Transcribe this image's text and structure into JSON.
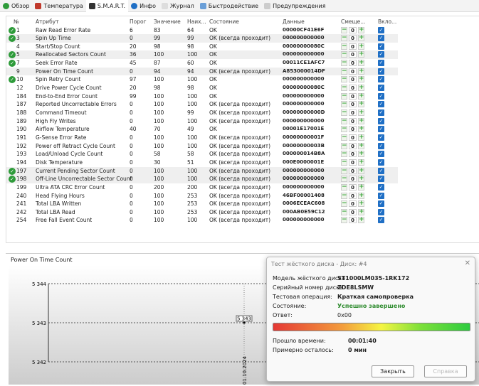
{
  "tabs": [
    {
      "label": "Обзор",
      "icon": "check-circle-icon"
    },
    {
      "label": "Температура",
      "icon": "thermometer-icon"
    },
    {
      "label": "S.M.A.R.T.",
      "icon": "drive-icon"
    },
    {
      "label": "Инфо",
      "icon": "info-icon"
    },
    {
      "label": "Журнал",
      "icon": "document-icon"
    },
    {
      "label": "Быстродействие",
      "icon": "chart-icon"
    },
    {
      "label": "Предупреждения",
      "icon": "warning-doc-icon"
    }
  ],
  "active_tab": "S.M.A.R.T.",
  "columns": [
    "№",
    "Атрибут",
    "Порог",
    "Значение",
    "Наих...",
    "Состояние",
    "Данные",
    "Смеще...",
    "Вкло..."
  ],
  "rows": [
    [
      "1",
      "Raw Read Error Rate",
      "6",
      "83",
      "64",
      "OK",
      "00000CF41E6F",
      true
    ],
    [
      "3",
      "Spin Up Time",
      "0",
      "99",
      "99",
      "OK (всегда проходит)",
      "000000000000",
      true
    ],
    [
      "4",
      "Start/Stop Count",
      "20",
      "98",
      "98",
      "OK",
      "00000000080C",
      false
    ],
    [
      "5",
      "Reallocated Sectors Count",
      "36",
      "100",
      "100",
      "OK",
      "000000000000",
      true
    ],
    [
      "7",
      "Seek Error Rate",
      "45",
      "87",
      "60",
      "OK",
      "00011CE1AFC7",
      true
    ],
    [
      "9",
      "Power On Time Count",
      "0",
      "94",
      "94",
      "OK (всегда проходит)",
      "A853000014DF",
      false
    ],
    [
      "10",
      "Spin Retry Count",
      "97",
      "100",
      "100",
      "OK",
      "000000000000",
      true
    ],
    [
      "12",
      "Drive Power Cycle Count",
      "20",
      "98",
      "98",
      "OK",
      "00000000080C",
      false
    ],
    [
      "184",
      "End-to-End Error Count",
      "99",
      "100",
      "100",
      "OK",
      "000000000000",
      false
    ],
    [
      "187",
      "Reported Uncorrectable Errors",
      "0",
      "100",
      "100",
      "OK (всегда проходит)",
      "000000000000",
      false
    ],
    [
      "188",
      "Command Timeout",
      "0",
      "100",
      "99",
      "OK (всегда проходит)",
      "00000000000D",
      false
    ],
    [
      "189",
      "High Fly Writes",
      "0",
      "100",
      "100",
      "OK (всегда проходит)",
      "000000000000",
      false
    ],
    [
      "190",
      "Airflow Temperature",
      "40",
      "70",
      "49",
      "OK",
      "00001E17001E",
      false
    ],
    [
      "191",
      "G-Sense Error Rate",
      "0",
      "100",
      "100",
      "OK (всегда проходит)",
      "00000000001F",
      false
    ],
    [
      "192",
      "Power off Retract Cycle Count",
      "0",
      "100",
      "100",
      "OK (всегда проходит)",
      "00000000003B",
      false
    ],
    [
      "193",
      "Load/Unload Cycle Count",
      "0",
      "58",
      "58",
      "OK (всегда проходит)",
      "000000014B8A",
      false
    ],
    [
      "194",
      "Disk Temperature",
      "0",
      "30",
      "51",
      "OK (всегда проходит)",
      "000E0000001E",
      false
    ],
    [
      "197",
      "Current Pending Sector Count",
      "0",
      "100",
      "100",
      "OK (всегда проходит)",
      "000000000000",
      true
    ],
    [
      "198",
      "Off-Line Uncorrectable Sector Count",
      "0",
      "100",
      "100",
      "OK (всегда проходит)",
      "000000000000",
      true
    ],
    [
      "199",
      "Ultra ATA CRC Error Count",
      "0",
      "200",
      "200",
      "OK (всегда проходит)",
      "000000000000",
      false
    ],
    [
      "240",
      "Head Flying Hours",
      "0",
      "100",
      "253",
      "OK (всегда проходит)",
      "46BF00001408",
      false
    ],
    [
      "241",
      "Total LBA Written",
      "0",
      "100",
      "253",
      "OK (всегда проходит)",
      "0006ECEAC608",
      false
    ],
    [
      "242",
      "Total LBA Read",
      "0",
      "100",
      "253",
      "OK (всегда проходит)",
      "000AB0E59C12",
      false
    ],
    [
      "254",
      "Free Fall Event Count",
      "0",
      "100",
      "100",
      "OK (всегда проходит)",
      "000000000000",
      false
    ]
  ],
  "offset_value": "0",
  "chart": {
    "tab": "Power On Time Count",
    "y_ticks": [
      "5 344",
      "5 343",
      "5 342"
    ],
    "point_label": "5 343",
    "x_label": "01.10.2024"
  },
  "chart_data": {
    "type": "line",
    "x": [
      "01.10.2024"
    ],
    "values": [
      5343
    ],
    "ylim": [
      5342,
      5344
    ],
    "grid": true
  },
  "dialog": {
    "title": "Тест жёсткого диска - Диск: #4",
    "model_label": "Модель жёсткого диска",
    "model": "ST1000LM035-1RK172",
    "serial_label": "Серийный номер диска",
    "serial": "ZDE8LSMW",
    "op_label": "Тестовая операция:",
    "op": "Краткая самопроверка",
    "state_label": "Состояние:",
    "state": "Успешно завершено",
    "answer_label": "Ответ:",
    "answer": "0x00",
    "progress": 100,
    "elapsed_label": "Прошло времени:",
    "elapsed": "00:01:40",
    "remaining_label": "Примерно осталось:",
    "remaining": "0 мин",
    "close": "Закрыть",
    "second_button": "Справка"
  }
}
